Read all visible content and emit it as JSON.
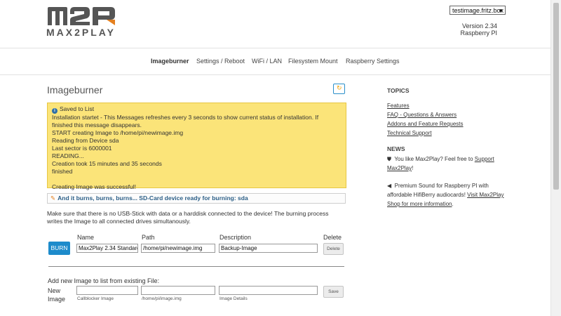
{
  "header": {
    "logo_text": "MAX2PLAY",
    "host_select": "testimage.fritz.box",
    "version": "Version 2.34",
    "platform": "Raspberry PI"
  },
  "nav": {
    "items": [
      "Imageburner",
      "Settings / Reboot",
      "WiFi / LAN",
      "Filesystem Mount",
      "Raspberry Settings"
    ],
    "active": "Imageburner"
  },
  "main": {
    "title": "Imageburner",
    "notice": {
      "lines": [
        "Saved to List",
        "Installation startet - This Messages refreshes every 3 seconds to show current status of installation. If",
        "finished this message disappears.",
        "START creating Image to /home/pi/newimage.img",
        "Reading from Device sda",
        "Last sector is 6000001",
        "READING...",
        "Creation took 15 minutes and 35 seconds",
        "finished",
        "",
        "Creating Image was successful!"
      ]
    },
    "burn_status": "And it burns, burns, burns... SD-Card device ready for burning: sda",
    "description_line1": "Make sure that there is no USB-Stick with data or a harddisk connected to the device! The burning process",
    "description_line2": "writes the Image to all connected drives simultanously.",
    "table": {
      "headers": [
        "Name",
        "Path",
        "Description",
        "Delete"
      ],
      "row": {
        "burn_label": "BURN",
        "name": "Max2Play 2.34 Standard",
        "path": "/home/pi/newimage.img",
        "description": "Backup-Image",
        "delete_label": "Delete"
      }
    },
    "add_new": {
      "heading": "Add new Image to list from existing File:",
      "label_line1": "New",
      "label_line2": "Image",
      "hint_name": "Callblocker Image",
      "hint_path": "/home/pi/image.img",
      "hint_desc": "Image Details",
      "save_label": "Save"
    }
  },
  "sidebar": {
    "topics_heading": "TOPICS",
    "topics": [
      "Features",
      "FAQ - Questions & Answers",
      "Addons and Feature Requests",
      "Technical Support"
    ],
    "news_heading": "NEWS",
    "news1_l1_a": "You like Max2Play? Feel free to ",
    "news1_l1_link": "Support",
    "news1_l2_link": "Max2Play",
    "news1_l2_b": "!",
    "news2_l1": "Premium Sound for Raspberry PI with",
    "news2_l2_a": "affordable HifiBerry audiocards! ",
    "news2_l2_link": "Visit Max2Play",
    "news2_l3_link": "Shop for more information",
    "news2_l3_b": "."
  },
  "colors": {
    "accent": "#1d8bcb",
    "notice_bg": "#fbe479",
    "logo_orange": "#e4801f"
  }
}
